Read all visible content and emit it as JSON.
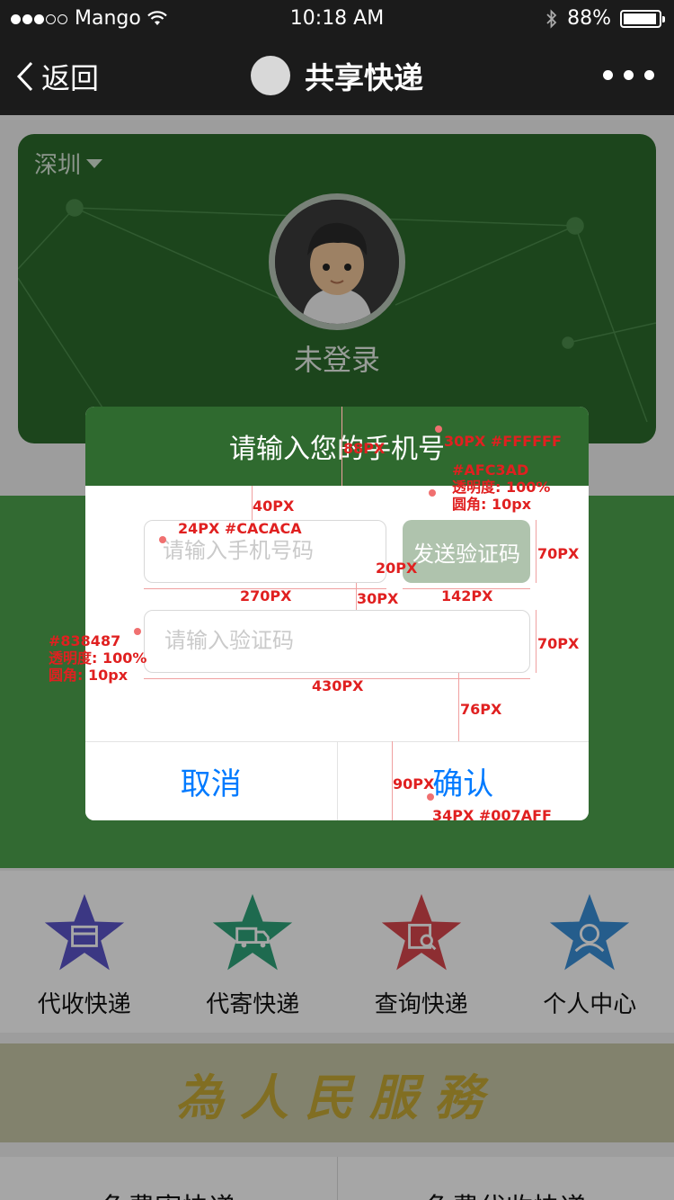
{
  "status_bar": {
    "carrier": "Mango",
    "time": "10:18 AM",
    "battery_text": "88%",
    "battery_level": 0.88,
    "signal_bars_filled": 3,
    "signal_bars_total": 5
  },
  "nav": {
    "back_label": "返回",
    "title": "共享快递"
  },
  "profile": {
    "city": "深圳",
    "login_status": "未登录"
  },
  "menu": {
    "items": [
      {
        "label": "代收快递",
        "icon": "package-icon",
        "color": "#5b55c9"
      },
      {
        "label": "代寄快递",
        "icon": "truck-icon",
        "color": "#2fa37a"
      },
      {
        "label": "查询快递",
        "icon": "search-doc-icon",
        "color": "#d9484e"
      },
      {
        "label": "个人中心",
        "icon": "user-icon",
        "color": "#3a8fd8"
      }
    ]
  },
  "slogan": "為人民服務",
  "bottom_tabs": [
    "免费寄快递",
    "免费代收快递"
  ],
  "dialog": {
    "title": "请输入您的手机号",
    "phone_placeholder": "请输入手机号码",
    "send_code_label": "发送验证码",
    "code_placeholder": "请输入验证码",
    "cancel_label": "取消",
    "confirm_label": "确认"
  },
  "annotations": {
    "header_height": "88PX",
    "title_font": "30PX #FFFFFF",
    "button_spec": [
      "#AFC3AD",
      "透明度: 100%",
      "圆角: 10px"
    ],
    "gap_top": "40PX",
    "placeholder_font": "24PX #CACACA",
    "gap_between": "20PX",
    "field_height_1": "70PX",
    "phone_width": "270PX",
    "row_gap": "30PX",
    "button_width": "142PX",
    "border_spec": [
      "#838487",
      "透明度: 100%",
      "圆角: 10px"
    ],
    "field_height_2": "70PX",
    "code_width": "430PX",
    "gap_bottom": "76PX",
    "footer_height": "90PX",
    "confirm_font": "34PX #007AFF"
  },
  "colors": {
    "dialog_header": "#2f6a2f",
    "send_button": "#AFC3AD",
    "placeholder": "#CACACA",
    "confirm": "#007AFF"
  }
}
